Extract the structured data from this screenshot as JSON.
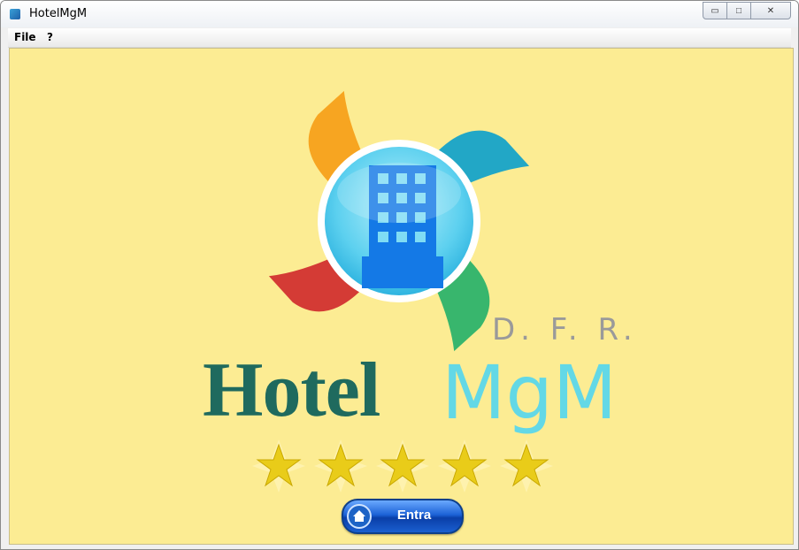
{
  "window": {
    "title": "HotelMgM",
    "controls": {
      "minimize": "▭",
      "maximize": "□",
      "close": "✕"
    }
  },
  "menubar": {
    "items": [
      "File",
      "?"
    ]
  },
  "logo": {
    "initials": "D. F. R.",
    "word1": "Hotel",
    "word2": "MgM",
    "colors": {
      "hotel": "#1f6a5e",
      "mgm": "#63d8e6",
      "orange": "#f7a11a",
      "teal": "#16a3c8",
      "green": "#2db36a",
      "red": "#d2312f",
      "building": "#1479e6"
    },
    "icon": "building-icon"
  },
  "rating": {
    "stars": 5
  },
  "enter_button": {
    "label": "Entra",
    "icon": "home-icon"
  }
}
